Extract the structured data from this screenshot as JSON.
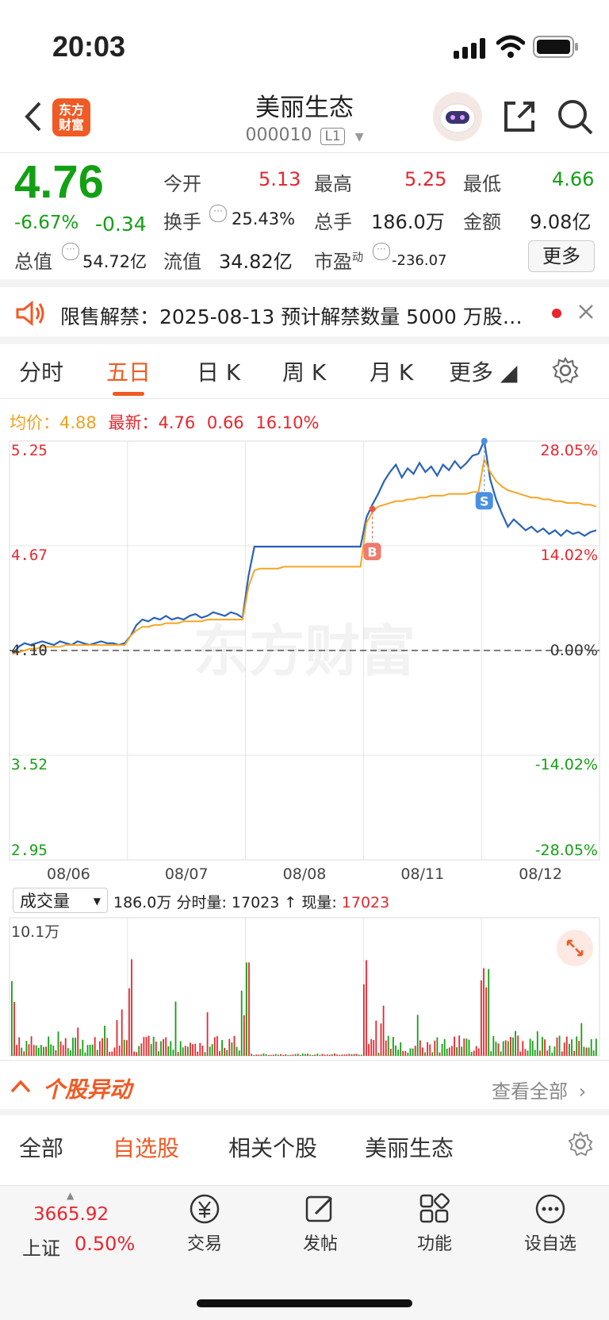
{
  "status": {
    "time": "20:03"
  },
  "header": {
    "title": "美丽生态",
    "code": "000010",
    "level": "L1"
  },
  "quote": {
    "price": "4.76",
    "change_pct": "-6.67%",
    "change": "-0.34",
    "open_label": "今开",
    "open": "5.13",
    "high_label": "最高",
    "high": "5.25",
    "low_label": "最低",
    "low": "4.66",
    "turnover_label": "换手",
    "turnover": "25.43%",
    "volume_label": "总手",
    "volume": "186.0万",
    "amount_label": "金额",
    "amount": "9.08亿",
    "mktcap_label": "总值",
    "mktcap": "54.72亿",
    "float_label": "流值",
    "float": "34.82亿",
    "pe_label": "市盈",
    "pe_sup": "动",
    "pe": "-236.07",
    "more": "更多"
  },
  "notice": {
    "text": "限售解禁：2025-08-13 预计解禁数量 5000 万股…"
  },
  "tabs": [
    "分时",
    "五日",
    "日 K",
    "周 K",
    "月 K",
    "更多"
  ],
  "active_tab": 1,
  "chart_info": {
    "avg_label": "均价：",
    "avg": "4.88",
    "latest_label": "最新：",
    "latest": "4.76",
    "diff": "0.66",
    "pct": "16.10%"
  },
  "chart_data": {
    "type": "line",
    "title": "",
    "x_ticks": [
      "08/06",
      "08/07",
      "08/08",
      "08/11",
      "08/12"
    ],
    "y_left": [
      "5.25",
      "4.67",
      "4.10",
      "3.52",
      "2.95"
    ],
    "y_right": [
      "28.05%",
      "14.02%",
      "0.00%",
      "-14.02%",
      "-28.05%"
    ],
    "ylim": [
      2.95,
      5.25
    ],
    "prev_close": 4.1,
    "series": [
      {
        "values": [
          4.08,
          4.12,
          4.14,
          4.13,
          4.14,
          4.15,
          4.14,
          4.13,
          4.15,
          4.14,
          4.13,
          4.15,
          4.14,
          4.13,
          4.14,
          4.15,
          4.14,
          4.14,
          4.13,
          4.14,
          4.18,
          4.24,
          4.27,
          4.26,
          4.28,
          4.27,
          4.29,
          4.27,
          4.28,
          4.27,
          4.29,
          4.3,
          4.28,
          4.29,
          4.31,
          4.3,
          4.29,
          4.31,
          4.3,
          4.28,
          4.51,
          4.67,
          4.67,
          4.67,
          4.67,
          4.67,
          4.67,
          4.67,
          4.67,
          4.67,
          4.67,
          4.67,
          4.67,
          4.67,
          4.67,
          4.67,
          4.67,
          4.67,
          4.67,
          4.67,
          4.83,
          4.9,
          4.96,
          5.03,
          5.08,
          5.12,
          5.05,
          5.1,
          5.07,
          5.13,
          5.08,
          5.11,
          5.06,
          5.12,
          5.09,
          5.14,
          5.1,
          5.13,
          5.17,
          5.18,
          5.25,
          5.04,
          4.93,
          4.85,
          4.78,
          4.82,
          4.79,
          4.76,
          4.78,
          4.75,
          4.77,
          4.74,
          4.76,
          4.73,
          4.76,
          4.74,
          4.75,
          4.73,
          4.75,
          4.76
        ]
      },
      {
        "values": [
          4.08,
          4.09,
          4.1,
          4.11,
          4.11,
          4.12,
          4.12,
          4.12,
          4.12,
          4.13,
          4.13,
          4.13,
          4.13,
          4.13,
          4.13,
          4.13,
          4.13,
          4.13,
          4.13,
          4.13,
          4.18,
          4.21,
          4.23,
          4.23,
          4.24,
          4.24,
          4.25,
          4.25,
          4.25,
          4.26,
          4.26,
          4.26,
          4.26,
          4.27,
          4.27,
          4.27,
          4.27,
          4.27,
          4.27,
          4.27,
          4.45,
          4.54,
          4.55,
          4.55,
          4.55,
          4.55,
          4.56,
          4.56,
          4.56,
          4.56,
          4.56,
          4.56,
          4.56,
          4.56,
          4.56,
          4.56,
          4.56,
          4.56,
          4.56,
          4.56,
          4.8,
          4.86,
          4.89,
          4.9,
          4.91,
          4.92,
          4.92,
          4.93,
          4.93,
          4.94,
          4.94,
          4.95,
          4.95,
          4.95,
          4.96,
          4.96,
          4.96,
          4.96,
          4.97,
          4.97,
          5.15,
          5.08,
          5.03,
          5.0,
          4.98,
          4.97,
          4.96,
          4.95,
          4.94,
          4.94,
          4.93,
          4.93,
          4.92,
          4.92,
          4.91,
          4.91,
          4.91,
          4.9,
          4.9,
          4.89
        ]
      }
    ],
    "markers": [
      {
        "label": "B"
      },
      {
        "label": "S"
      }
    ],
    "watermark": "东方财富"
  },
  "volume": {
    "selector": "成交量",
    "total": "186.0万",
    "detail": "分时量: 17023 ↑ 现量:",
    "current": "17023",
    "max_label": "10.1万"
  },
  "movement": {
    "title": "个股异动",
    "view_all": "查看全部"
  },
  "filter_tabs": [
    "全部",
    "自选股",
    "相关个股",
    "美丽生态"
  ],
  "bottom": {
    "index_value": "3665.92",
    "index_name": "上证",
    "index_pct": "0.50%",
    "items": [
      "交易",
      "发帖",
      "功能",
      "设自选"
    ]
  }
}
